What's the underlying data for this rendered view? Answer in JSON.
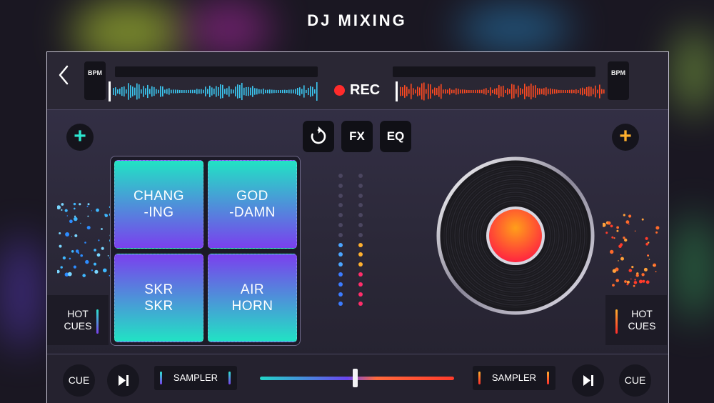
{
  "app": {
    "title": "DJ MIXING"
  },
  "deck_left": {
    "bpm_label": "BPM",
    "hot_cues_label_1": "HOT",
    "hot_cues_label_2": "CUES",
    "cue_label": "CUE",
    "sampler_label": "SAMPLER"
  },
  "deck_right": {
    "bpm_label": "BPM",
    "hot_cues_label_1": "HOT",
    "hot_cues_label_2": "CUES",
    "cue_label": "CUE",
    "sampler_label": "SAMPLER"
  },
  "center": {
    "rec_label": "REC",
    "fx_label": "FX",
    "eq_label": "EQ",
    "crossfader_position": 0.49
  },
  "pads": [
    {
      "line1": "CHANG",
      "line2": "-ING"
    },
    {
      "line1": "GOD",
      "line2": "-DAMN"
    },
    {
      "line1": "SKR",
      "line2": "SKR"
    },
    {
      "line1": "AIR",
      "line2": "HORN"
    }
  ],
  "icons": {
    "back": "chevron-left-icon",
    "add": "plus-icon",
    "reset": "rotate-icon",
    "play_pause": "play-pause-icon",
    "record": "record-dot-icon"
  },
  "colors": {
    "left_accent": "#2ce6cf",
    "right_accent": "#ffb02e",
    "left_wave": "#3cc8f2",
    "right_wave": "#ff4a22",
    "record": "#ff2b2b"
  },
  "meters": {
    "left_level": 0.5,
    "right_level": 0.5
  }
}
